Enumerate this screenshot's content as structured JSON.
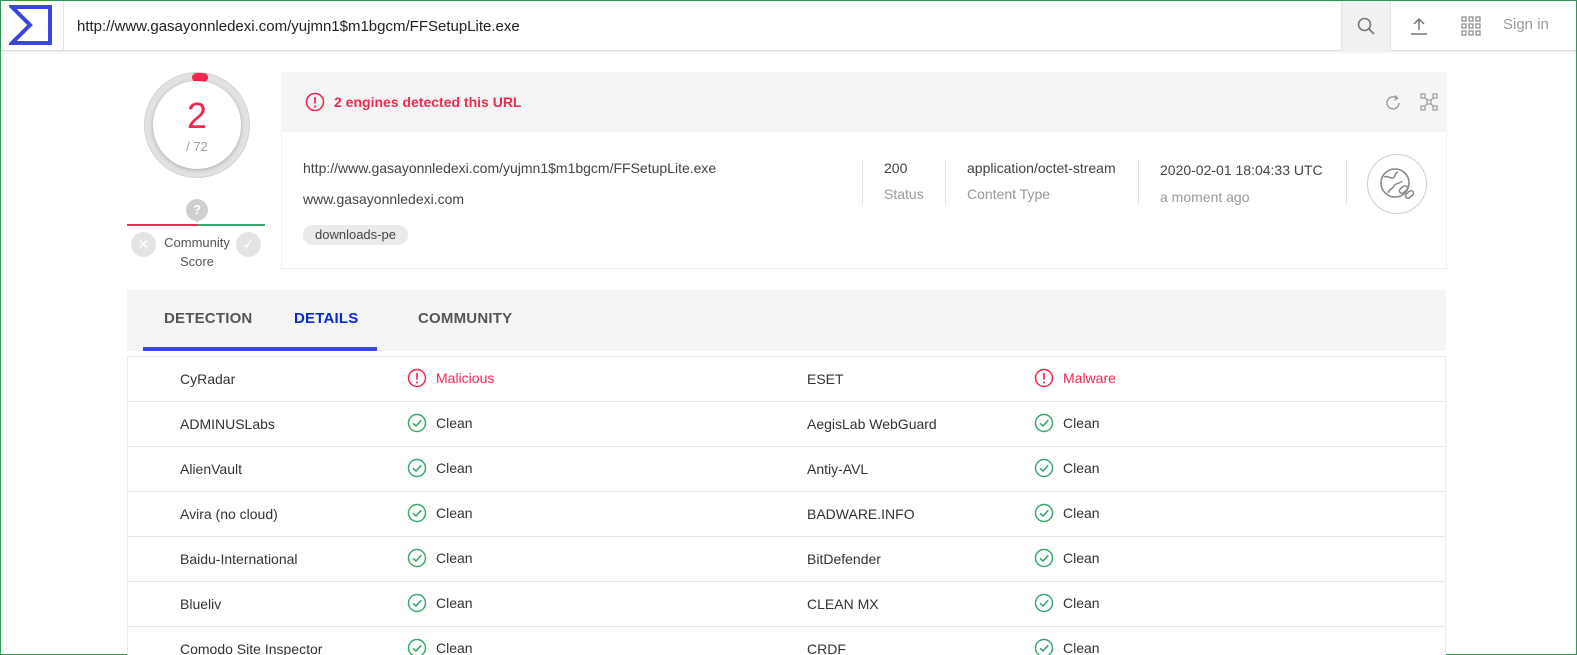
{
  "topbar": {
    "url_value": "http://www.gasayonnledexi.com/yujmn1$m1bgcm/FFSetupLite.exe",
    "sign_in": "Sign in",
    "icons": [
      "virustotal-logo",
      "search-icon",
      "upload-icon",
      "apps-grid-icon"
    ]
  },
  "score": {
    "detections": "2",
    "total": "/ 72",
    "community_label_1": "Community",
    "community_label_2": "Score",
    "community_unknown": "?"
  },
  "summary": {
    "alert": "2 engines detected this URL",
    "url": "http://www.gasayonnledexi.com/yujmn1$m1bgcm/FFSetupLite.exe",
    "domain": "www.gasayonnledexi.com",
    "tag": "downloads-pe",
    "status_value": "200",
    "status_label": "Status",
    "content_type_value": "application/octet-stream",
    "content_type_label": "Content Type",
    "date_value": "2020-02-01 18:04:33 UTC",
    "date_label": "a moment ago"
  },
  "tabs": [
    {
      "label": "DETECTION"
    },
    {
      "label": "DETAILS",
      "active": true
    },
    {
      "label": "COMMUNITY"
    }
  ],
  "colors": {
    "malicious": "#f2294e",
    "clean": "#3aa76d",
    "accent": "#3b46e0"
  },
  "results": [
    [
      {
        "engine": "CyRadar",
        "result": "Malicious",
        "status": "bad"
      },
      {
        "engine": "ESET",
        "result": "Malware",
        "status": "bad"
      }
    ],
    [
      {
        "engine": "ADMINUSLabs",
        "result": "Clean",
        "status": "good"
      },
      {
        "engine": "AegisLab WebGuard",
        "result": "Clean",
        "status": "good"
      }
    ],
    [
      {
        "engine": "AlienVault",
        "result": "Clean",
        "status": "good"
      },
      {
        "engine": "Antiy-AVL",
        "result": "Clean",
        "status": "good"
      }
    ],
    [
      {
        "engine": "Avira (no cloud)",
        "result": "Clean",
        "status": "good"
      },
      {
        "engine": "BADWARE.INFO",
        "result": "Clean",
        "status": "good"
      }
    ],
    [
      {
        "engine": "Baidu-International",
        "result": "Clean",
        "status": "good"
      },
      {
        "engine": "BitDefender",
        "result": "Clean",
        "status": "good"
      }
    ],
    [
      {
        "engine": "Blueliv",
        "result": "Clean",
        "status": "good"
      },
      {
        "engine": "CLEAN MX",
        "result": "Clean",
        "status": "good"
      }
    ],
    [
      {
        "engine": "Comodo Site Inspector",
        "result": "Clean",
        "status": "good"
      },
      {
        "engine": "CRDF",
        "result": "Clean",
        "status": "good"
      }
    ]
  ]
}
